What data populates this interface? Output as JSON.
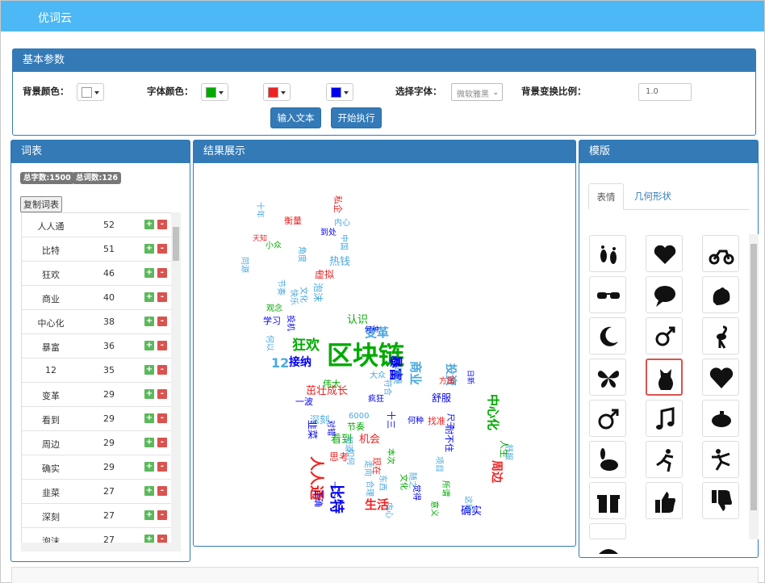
{
  "app": {
    "title": "优词云"
  },
  "params": {
    "heading": "基本参数",
    "bg_color_label": "背景颜色：",
    "font_color_label": "字体颜色：",
    "font_label": "选择字体：",
    "font_value": "微软雅黑",
    "ratio_label": "背景变换比例：",
    "ratio_value": "1.0",
    "input_btn": "输入文本",
    "run_btn": "开始执行",
    "colors": {
      "background": "#ffffff",
      "font1": "#00aa00",
      "font2": "#ee2222",
      "font3": "#0000ee"
    }
  },
  "wordlist": {
    "heading": "词表",
    "total_chars": "总字数:1500",
    "total_words": "总词数:126",
    "copy_btn": "复制词表",
    "rows": [
      {
        "word": "人人通",
        "count": "52"
      },
      {
        "word": "比特",
        "count": "51"
      },
      {
        "word": "狂欢",
        "count": "46"
      },
      {
        "word": "商业",
        "count": "40"
      },
      {
        "word": "中心化",
        "count": "38"
      },
      {
        "word": "暴富",
        "count": "36"
      },
      {
        "word": "12",
        "count": "35"
      },
      {
        "word": "变革",
        "count": "29"
      },
      {
        "word": "看到",
        "count": "29"
      },
      {
        "word": "周边",
        "count": "29"
      },
      {
        "word": "确实",
        "count": "29"
      },
      {
        "word": "韭菜",
        "count": "27"
      },
      {
        "word": "深刻",
        "count": "27"
      },
      {
        "word": "泡沫",
        "count": "27"
      }
    ],
    "plus": "+",
    "minus": "-"
  },
  "result": {
    "heading": "结果展示"
  },
  "template": {
    "heading": "模版",
    "tab_emoji": "表情",
    "tab_shapes": "几何形状",
    "icons": [
      "footprints-icon",
      "hearts-icon",
      "motorcycle-icon",
      "sunglasses-icon",
      "speech-bubble-icon",
      "rooster-icon",
      "moon-icon",
      "gender-icon",
      "heron-icon",
      "butterfly-icon",
      "cat-icon",
      "heart-icon",
      "male-icon",
      "music-note-icon",
      "piggy-bank-icon",
      "rabbit-icon",
      "runner-icon",
      "skater-icon",
      "gift-icon",
      "thumbs-up-icon",
      "thumbs-down-icon",
      "partial-icon"
    ]
  },
  "cloud": {
    "words": [
      {
        "t": "区块链",
        "c": "#00aa00"
      },
      {
        "t": "狂欢",
        "c": "#00aa00"
      },
      {
        "t": "变革",
        "c": "#4aa8e0"
      },
      {
        "t": "12",
        "c": "#4aa8e0"
      },
      {
        "t": "接纳",
        "c": "#0000ee"
      },
      {
        "t": "认识",
        "c": "#00aa00"
      },
      {
        "t": "热钱",
        "c": "#4aa8e0"
      },
      {
        "t": "虚拟",
        "c": "#ee2222"
      },
      {
        "t": "学习",
        "c": "#0000ee"
      },
      {
        "t": "观念",
        "c": "#00aa00"
      },
      {
        "t": "到处",
        "c": "#0000ee"
      },
      {
        "t": "衡量",
        "c": "#ee2222"
      },
      {
        "t": "茁壮成长",
        "c": "#ee2222"
      },
      {
        "t": "舒服",
        "c": "#0000ee"
      },
      {
        "t": "深刻",
        "c": "#4aa8e0"
      },
      {
        "t": "看到",
        "c": "#00aa00"
      },
      {
        "t": "机会",
        "c": "#ee2222"
      },
      {
        "t": "思考",
        "c": "#ee2222"
      },
      {
        "t": "一波",
        "c": "#0000ee"
      },
      {
        "t": "人人通",
        "c": "#ee2222"
      },
      {
        "t": "比特",
        "c": "#0000ee"
      },
      {
        "t": "生活",
        "c": "#ee2222"
      },
      {
        "t": "确实",
        "c": "#0000ee"
      },
      {
        "t": "中心化",
        "c": "#00aa00"
      },
      {
        "t": "周边",
        "c": "#ee2222"
      },
      {
        "t": "暴富",
        "c": "#0000ee"
      },
      {
        "t": "人生",
        "c": "#00aa00"
      },
      {
        "t": "商业",
        "c": "#4aa8e0"
      },
      {
        "t": "投资",
        "c": "#4aa8e0"
      },
      {
        "t": "韭菜",
        "c": "#0000ee"
      },
      {
        "t": "泡沫",
        "c": "#4aa8e0"
      },
      {
        "t": "找准",
        "c": "#ee2222"
      },
      {
        "t": "何种",
        "c": "#0000ee"
      },
      {
        "t": "6000",
        "c": "#4aa8e0"
      },
      {
        "t": "节奏",
        "c": "#00aa00"
      },
      {
        "t": "对错",
        "c": "#0000ee"
      },
      {
        "t": "私企",
        "c": "#ee2222"
      },
      {
        "t": "内心",
        "c": "#4aa8e0"
      },
      {
        "t": "节奏",
        "c": "#4aa8e0"
      },
      {
        "t": "伟大",
        "c": "#00aa00"
      },
      {
        "t": "大众",
        "c": "#4aa8e0"
      },
      {
        "t": "疯狂",
        "c": "#0000ee"
      },
      {
        "t": "耐不住",
        "c": "#0000ee"
      },
      {
        "t": "舒服",
        "c": "#4aa8e0"
      },
      {
        "t": "方属",
        "c": "#ee2222"
      },
      {
        "t": "尺子",
        "c": "#0000ee"
      },
      {
        "t": "日新",
        "c": "#0000ee"
      },
      {
        "t": "项目",
        "c": "#4aa8e0"
      },
      {
        "t": "这种",
        "c": "#4aa8e0"
      },
      {
        "t": "所谓",
        "c": "#00aa00"
      },
      {
        "t": "意义",
        "c": "#00aa00"
      },
      {
        "t": "内心",
        "c": "#4aa8e0"
      },
      {
        "t": "符合",
        "c": "#4aa8e0"
      },
      {
        "t": "现在",
        "c": "#ee2222"
      },
      {
        "t": "如何",
        "c": "#4aa8e0"
      },
      {
        "t": "十三",
        "c": "#0000ee"
      },
      {
        "t": "环境",
        "c": "#4aa8e0"
      },
      {
        "t": "本次",
        "c": "#00aa00"
      },
      {
        "t": "正确",
        "c": "#0000ee"
      },
      {
        "t": "合理",
        "c": "#4aa8e0"
      },
      {
        "t": "文化",
        "c": "#00aa00"
      },
      {
        "t": "随之",
        "c": "#4aa8e0"
      },
      {
        "t": "觉得",
        "c": "#0000ee"
      },
      {
        "t": "东西",
        "c": "#4aa8e0"
      },
      {
        "t": "走向",
        "c": "#4aa8e0"
      },
      {
        "t": "何以",
        "c": "#4aa8e0"
      },
      {
        "t": "小众",
        "c": "#00aa00"
      },
      {
        "t": "天知",
        "c": "#ee2222"
      },
      {
        "t": "何种",
        "c": "#0000ee"
      },
      {
        "t": "角度",
        "c": "#4aa8e0"
      },
      {
        "t": "同源",
        "c": "#4aa8e0"
      },
      {
        "t": "十年",
        "c": "#4aa8e0"
      },
      {
        "t": "中国",
        "c": "#4aa8e0"
      },
      {
        "t": "文化",
        "c": "#4aa8e0"
      },
      {
        "t": "快乐",
        "c": "#4aa8e0"
      },
      {
        "t": "一下",
        "c": "#0000ee"
      },
      {
        "t": "投机",
        "c": "#0000ee"
      },
      {
        "t": "知道",
        "c": "#4aa8e0"
      }
    ]
  }
}
